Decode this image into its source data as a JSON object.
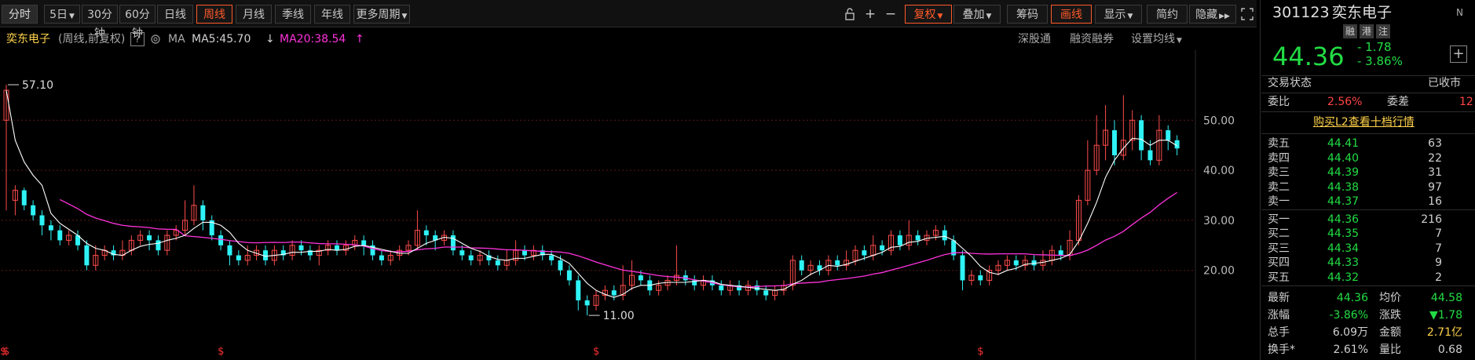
{
  "toolbar": {
    "buttons": [
      "分时",
      "5日",
      "30分钟",
      "60分钟",
      "日线",
      "周线",
      "月线",
      "季线",
      "年线",
      "更多周期"
    ],
    "right_buttons": [
      "复权",
      "叠加",
      "筹码",
      "画线",
      "显示",
      "简约",
      "隐藏"
    ]
  },
  "infobar": {
    "stock_name": "奕东电子",
    "mode": "(周线,前复权)",
    "help": "?",
    "ma_label": "MA",
    "ma5": "MA5:45.70",
    "ma20": "MA20:38.54",
    "links": [
      "深股通",
      "融资融券",
      "设置均线"
    ]
  },
  "chart_data": {
    "type": "candlestick",
    "period": "weekly",
    "y_ticks": [
      "50.00",
      "40.00",
      "30.00",
      "20.00"
    ],
    "ylim": [
      6,
      64
    ],
    "high_marker": "57.10",
    "low_marker": "11.00",
    "candles": [
      [
        50,
        56,
        57.1,
        32
      ],
      [
        34,
        36,
        37,
        31
      ],
      [
        36,
        33,
        36.5,
        32
      ],
      [
        33,
        31,
        34,
        30
      ],
      [
        31,
        29,
        32,
        27
      ],
      [
        29,
        28,
        30,
        26
      ],
      [
        28,
        26,
        29,
        25
      ],
      [
        26,
        27,
        28,
        25
      ],
      [
        27,
        25,
        28,
        24
      ],
      [
        25,
        21,
        26,
        20
      ],
      [
        21,
        23,
        25,
        20
      ],
      [
        23,
        24,
        25,
        22
      ],
      [
        24,
        23,
        25,
        22
      ],
      [
        23,
        24,
        26,
        22
      ],
      [
        24,
        26,
        27,
        23
      ],
      [
        26,
        27,
        28,
        25
      ],
      [
        27,
        26,
        28,
        24
      ],
      [
        26,
        24,
        27,
        23
      ],
      [
        24,
        27,
        28,
        23
      ],
      [
        27,
        28,
        29,
        26
      ],
      [
        28,
        30,
        34,
        27
      ],
      [
        30,
        33,
        37,
        29
      ],
      [
        33,
        30,
        34,
        28
      ],
      [
        30,
        27,
        31,
        26
      ],
      [
        27,
        25,
        28,
        24
      ],
      [
        25,
        23,
        26,
        21
      ],
      [
        23,
        22,
        24,
        21
      ],
      [
        22,
        23,
        25,
        21
      ],
      [
        23,
        24,
        25,
        22
      ],
      [
        24,
        22,
        25,
        21
      ],
      [
        22,
        24,
        25,
        21
      ],
      [
        24,
        23,
        25,
        22
      ],
      [
        23,
        25,
        26,
        22
      ],
      [
        25,
        24,
        26,
        23
      ],
      [
        24,
        23,
        25,
        22
      ],
      [
        23,
        24,
        25,
        21
      ],
      [
        24,
        25,
        26,
        23
      ],
      [
        25,
        24,
        26,
        23
      ],
      [
        24,
        25,
        26,
        23
      ],
      [
        25,
        26,
        27,
        24
      ],
      [
        26,
        25,
        27,
        23
      ],
      [
        25,
        23,
        26,
        22
      ],
      [
        23,
        22,
        24,
        21
      ],
      [
        22,
        23,
        24,
        21
      ],
      [
        23,
        24,
        25,
        22
      ],
      [
        24,
        25,
        26,
        23
      ],
      [
        25,
        28,
        32,
        24
      ],
      [
        28,
        27,
        29,
        25
      ],
      [
        27,
        26,
        28,
        24
      ],
      [
        26,
        27,
        28,
        25
      ],
      [
        27,
        24,
        28,
        23
      ],
      [
        24,
        23,
        25,
        22
      ],
      [
        23,
        22,
        24,
        21
      ],
      [
        22,
        23,
        24,
        21
      ],
      [
        23,
        22,
        24,
        21
      ],
      [
        22,
        21,
        23,
        20
      ],
      [
        21,
        22,
        24,
        20
      ],
      [
        22,
        24,
        26,
        21
      ],
      [
        24,
        23,
        25,
        22
      ],
      [
        23,
        24,
        25,
        22
      ],
      [
        24,
        23,
        25,
        22
      ],
      [
        23,
        22,
        24,
        21
      ],
      [
        22,
        20,
        23,
        19
      ],
      [
        20,
        18,
        21,
        17
      ],
      [
        18,
        14,
        19,
        12
      ],
      [
        14,
        13,
        15,
        11
      ],
      [
        13,
        15,
        16,
        12
      ],
      [
        15,
        16,
        17,
        14
      ],
      [
        16,
        15,
        17,
        14
      ],
      [
        15,
        17,
        21,
        14
      ],
      [
        17,
        19,
        22,
        16
      ],
      [
        19,
        18,
        20,
        17
      ],
      [
        18,
        16,
        19,
        15
      ],
      [
        16,
        17,
        18,
        15
      ],
      [
        17,
        18,
        19,
        16
      ],
      [
        18,
        19,
        25,
        17
      ],
      [
        19,
        18,
        20,
        17
      ],
      [
        18,
        17,
        19,
        16
      ],
      [
        17,
        18,
        19,
        16
      ],
      [
        18,
        17,
        19,
        16
      ],
      [
        17,
        16,
        18,
        15
      ],
      [
        16,
        17,
        18,
        15
      ],
      [
        17,
        16,
        18,
        15
      ],
      [
        16,
        17,
        18,
        15
      ],
      [
        17,
        16,
        18,
        15
      ],
      [
        16,
        15,
        17,
        14
      ],
      [
        15,
        16,
        17,
        14
      ],
      [
        16,
        17,
        18,
        15
      ],
      [
        17,
        22,
        23,
        16
      ],
      [
        22,
        20,
        23,
        19
      ],
      [
        20,
        21,
        22,
        19
      ],
      [
        21,
        20,
        22,
        19
      ],
      [
        20,
        22,
        23,
        19
      ],
      [
        22,
        21,
        23,
        20
      ],
      [
        21,
        22,
        24,
        20
      ],
      [
        22,
        24,
        25,
        21
      ],
      [
        24,
        23,
        25,
        22
      ],
      [
        23,
        25,
        27,
        22
      ],
      [
        25,
        24,
        26,
        23
      ],
      [
        24,
        27,
        28,
        23
      ],
      [
        27,
        25,
        28,
        24
      ],
      [
        25,
        27,
        30,
        24
      ],
      [
        27,
        26,
        28,
        25
      ],
      [
        26,
        27,
        28,
        25
      ],
      [
        27,
        28,
        29,
        26
      ],
      [
        28,
        26,
        29,
        25
      ],
      [
        26,
        23,
        27,
        22
      ],
      [
        23,
        18,
        24,
        16
      ],
      [
        18,
        19,
        20,
        17
      ],
      [
        19,
        18,
        20,
        17
      ],
      [
        18,
        20,
        21,
        17
      ],
      [
        20,
        21,
        22,
        19
      ],
      [
        21,
        22,
        23,
        20
      ],
      [
        22,
        21,
        23,
        20
      ],
      [
        21,
        22,
        23,
        20
      ],
      [
        22,
        21,
        23,
        20
      ],
      [
        21,
        22,
        24,
        20
      ],
      [
        22,
        24,
        25,
        21
      ],
      [
        24,
        23,
        25,
        22
      ],
      [
        23,
        26,
        28,
        22
      ],
      [
        26,
        34,
        35,
        25
      ],
      [
        34,
        40,
        46,
        33
      ],
      [
        40,
        45,
        51,
        39
      ],
      [
        45,
        48,
        53,
        42
      ],
      [
        48,
        43,
        50,
        41
      ],
      [
        43,
        46,
        55,
        42
      ],
      [
        46,
        50,
        52,
        44
      ],
      [
        50,
        44,
        51,
        42
      ],
      [
        44,
        42,
        46,
        41
      ],
      [
        42,
        48,
        51,
        41
      ],
      [
        48,
        46,
        49,
        44
      ],
      [
        46,
        44.36,
        47,
        43
      ]
    ]
  },
  "right_panel": {
    "code": "301123",
    "name": "奕东电子",
    "tags": [
      "融",
      "港",
      "注"
    ],
    "price": "44.36",
    "change": "- 1.78",
    "change_pct": "- 3.86%",
    "status_label": "交易状态",
    "status_value": "已收市",
    "weibi_label": "委比",
    "weibi_value": "2.56%",
    "weicha_label": "委差",
    "weicha_value": "12",
    "l2_link": "购买L2查看十档行情",
    "asks": [
      {
        "label": "卖五",
        "price": "44.41",
        "vol": "63"
      },
      {
        "label": "卖四",
        "price": "44.40",
        "vol": "22"
      },
      {
        "label": "卖三",
        "price": "44.39",
        "vol": "31"
      },
      {
        "label": "卖二",
        "price": "44.38",
        "vol": "97"
      },
      {
        "label": "卖一",
        "price": "44.37",
        "vol": "16"
      }
    ],
    "bids": [
      {
        "label": "买一",
        "price": "44.36",
        "vol": "216"
      },
      {
        "label": "买二",
        "price": "44.35",
        "vol": "7"
      },
      {
        "label": "买三",
        "price": "44.34",
        "vol": "7"
      },
      {
        "label": "买四",
        "price": "44.33",
        "vol": "9"
      },
      {
        "label": "买五",
        "price": "44.32",
        "vol": "2"
      }
    ],
    "stats": [
      {
        "l1": "最新",
        "v1": "44.36",
        "l2": "均价",
        "v2": "44.58"
      },
      {
        "l1": "涨幅",
        "v1": "-3.86%",
        "l2": "涨跌",
        "v2": "▼1.78"
      },
      {
        "l1": "总手",
        "v1": "6.09万",
        "l2": "金额",
        "v2": "2.71亿"
      },
      {
        "l1": "换手*",
        "v1": "2.61%",
        "l2": "量比",
        "v2": "0.68"
      }
    ]
  }
}
